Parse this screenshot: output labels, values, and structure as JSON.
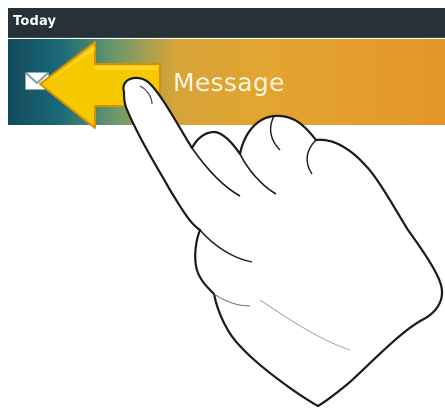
{
  "section_header": {
    "label": "Today"
  },
  "notification": {
    "label": "Message",
    "icon": "envelope-icon"
  },
  "gesture": {
    "arrow_icon": "arrow-left-icon",
    "hand_icon": "hand-swipe-icon",
    "direction": "left"
  },
  "colors": {
    "header_bg": "#263238",
    "row_start": "#144a5d",
    "row_end": "#e5952a",
    "arrow_fill": "#f5c800",
    "arrow_edge": "#d99000"
  }
}
